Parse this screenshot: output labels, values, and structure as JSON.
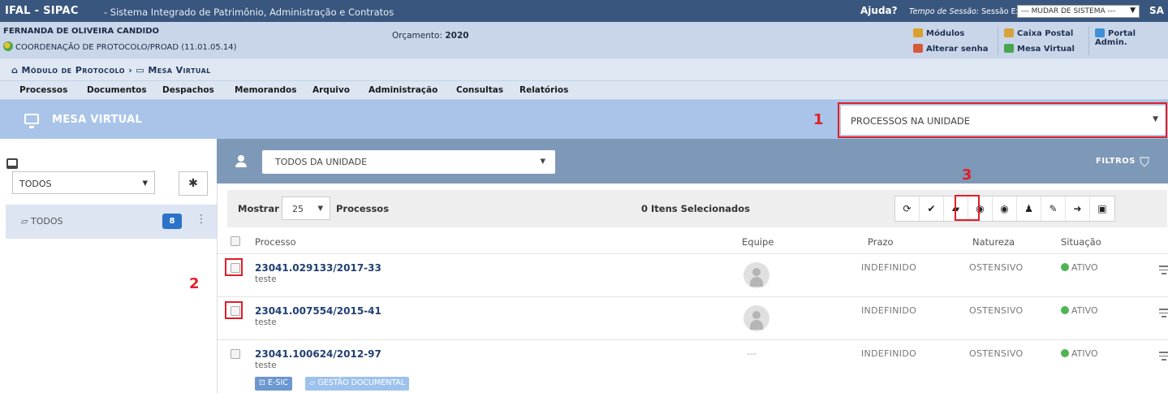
{
  "topbar": {
    "brand": "IFAL - SIPAC",
    "subtitle": "- Sistema Integrado de Patrimônio, Administração e Contratos",
    "ajuda": "Ajuda?",
    "sessao_label": "Tempo de Sessão:",
    "sessao_value": "Sessão Expirada",
    "mudar_sistema": "--- MUDAR DE SISTEMA ---",
    "right_text": "SA"
  },
  "infobar": {
    "user_name": "FERNANDA DE OLIVEIRA CANDIDO",
    "unit": "COORDENAÇÃO DE PROTOCOLO/PROAD (11.01.05.14)",
    "orcamento_label": "Orçamento:",
    "orcamento_value": "2020",
    "quick_links": {
      "modulos": "Módulos",
      "caixa_postal": "Caixa Postal",
      "portal_admin": "Portal Admin.",
      "alterar_senha": "Alterar senha",
      "mesa_virtual": "Mesa Virtual"
    }
  },
  "breadcrumb": {
    "home_icon": "home-icon",
    "module": "Módulo de Protocolo",
    "separator": "›",
    "page": "Mesa Virtual"
  },
  "menu": [
    "Processos",
    "Documentos",
    "Despachos",
    "Memorandos",
    "Arquivo",
    "Administração",
    "Consultas",
    "Relatórios"
  ],
  "mesa": {
    "title": "MESA VIRTUAL",
    "view_select": "PROCESSOS NA UNIDADE"
  },
  "annotations": [
    "1",
    "2",
    "3"
  ],
  "left": {
    "filter_select": "TODOS",
    "folder_label": "TODOS",
    "folder_count": "8"
  },
  "filter": {
    "scope_select": "TODOS DA UNIDADE",
    "filtros_label": "FILTROS"
  },
  "toolbar": {
    "mostrar": "Mostrar",
    "page_size": "25",
    "processos": "Processos",
    "selected": "0 Itens Selecionados",
    "buttons": [
      "refresh-icon",
      "check-icon",
      "open-folder-icon",
      "view-forward-icon",
      "view-check-icon",
      "add-user-icon",
      "pencil-icon",
      "export-icon",
      "pdf-icon"
    ]
  },
  "table": {
    "headers": {
      "processo": "Processo",
      "equipe": "Equipe",
      "prazo": "Prazo",
      "natureza": "Natureza",
      "situacao": "Situação"
    },
    "rows": [
      {
        "numero": "23041.029133/2017-33",
        "descricao": "teste",
        "equipe": "",
        "prazo": "INDEFINIDO",
        "natureza": "OSTENSIVO",
        "situacao": "ATIVO"
      },
      {
        "numero": "23041.007554/2015-41",
        "descricao": "teste",
        "equipe": "",
        "prazo": "INDEFINIDO",
        "natureza": "OSTENSIVO",
        "situacao": "ATIVO"
      },
      {
        "numero": "23041.100624/2012-97",
        "descricao": "teste",
        "equipe": "---",
        "prazo": "INDEFINIDO",
        "natureza": "OSTENSIVO",
        "situacao": "ATIVO",
        "tags": [
          "E-SIC",
          "GESTÃO DOCUMENTAL"
        ]
      }
    ]
  },
  "colors": {
    "topbar": "#39567e",
    "mesa_header": "#a9c4e8",
    "annotation_red": "#e01e28",
    "link_blue": "#213f74",
    "status_green": "#4fb453"
  }
}
